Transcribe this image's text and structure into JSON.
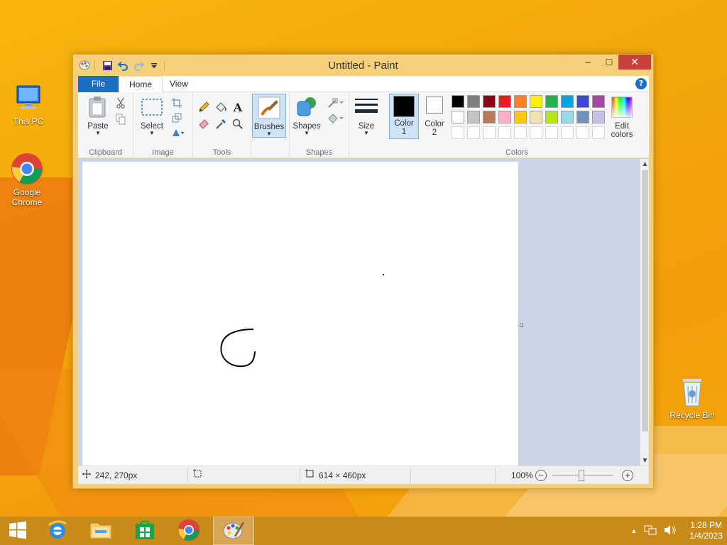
{
  "window": {
    "title": "Untitled - Paint",
    "minimize_glyph": "─",
    "maximize_glyph": "☐",
    "close_glyph": "✕"
  },
  "ribbon_tabs": {
    "file": "File",
    "home": "Home",
    "view": "View",
    "help_glyph": "?"
  },
  "ribbon": {
    "clipboard": {
      "label": "Clipboard",
      "paste": "Paste"
    },
    "image": {
      "label": "Image",
      "select": "Select"
    },
    "tools": {
      "label": "Tools",
      "text_glyph": "A"
    },
    "brushes": {
      "label": "Brushes"
    },
    "shapes": {
      "label": "Shapes",
      "shapes_btn": "Shapes"
    },
    "size": {
      "label": "Size"
    },
    "colors": {
      "label": "Colors",
      "color1_line1": "Color",
      "color1_line2": "1",
      "color2_line1": "Color",
      "color2_line2": "2",
      "edit_line1": "Edit",
      "edit_line2": "colors",
      "color1_value": "#000000",
      "color2_value": "#ffffff",
      "palette_row1": [
        "#000000",
        "#7f7f7f",
        "#880015",
        "#ed1c24",
        "#ff7f27",
        "#fff200",
        "#22b14c",
        "#00a2e8",
        "#3f48cc",
        "#a349a4"
      ],
      "palette_row2": [
        "#ffffff",
        "#c3c3c3",
        "#b97a57",
        "#ffaec9",
        "#ffc90e",
        "#efe4b0",
        "#b5e61d",
        "#99d9ea",
        "#7092be",
        "#c8bfe7"
      ]
    }
  },
  "status": {
    "cursor_pos": "242, 270px",
    "canvas_size": "614 × 460px",
    "zoom": "100%",
    "zoom_out_glyph": "−",
    "zoom_in_glyph": "+"
  },
  "desktop": {
    "this_pc": "This PC",
    "chrome": "Google Chrome",
    "recycle_bin": "Recycle Bin"
  },
  "taskbar": {
    "time": "1:28 PM",
    "date": "1/4/2023"
  }
}
